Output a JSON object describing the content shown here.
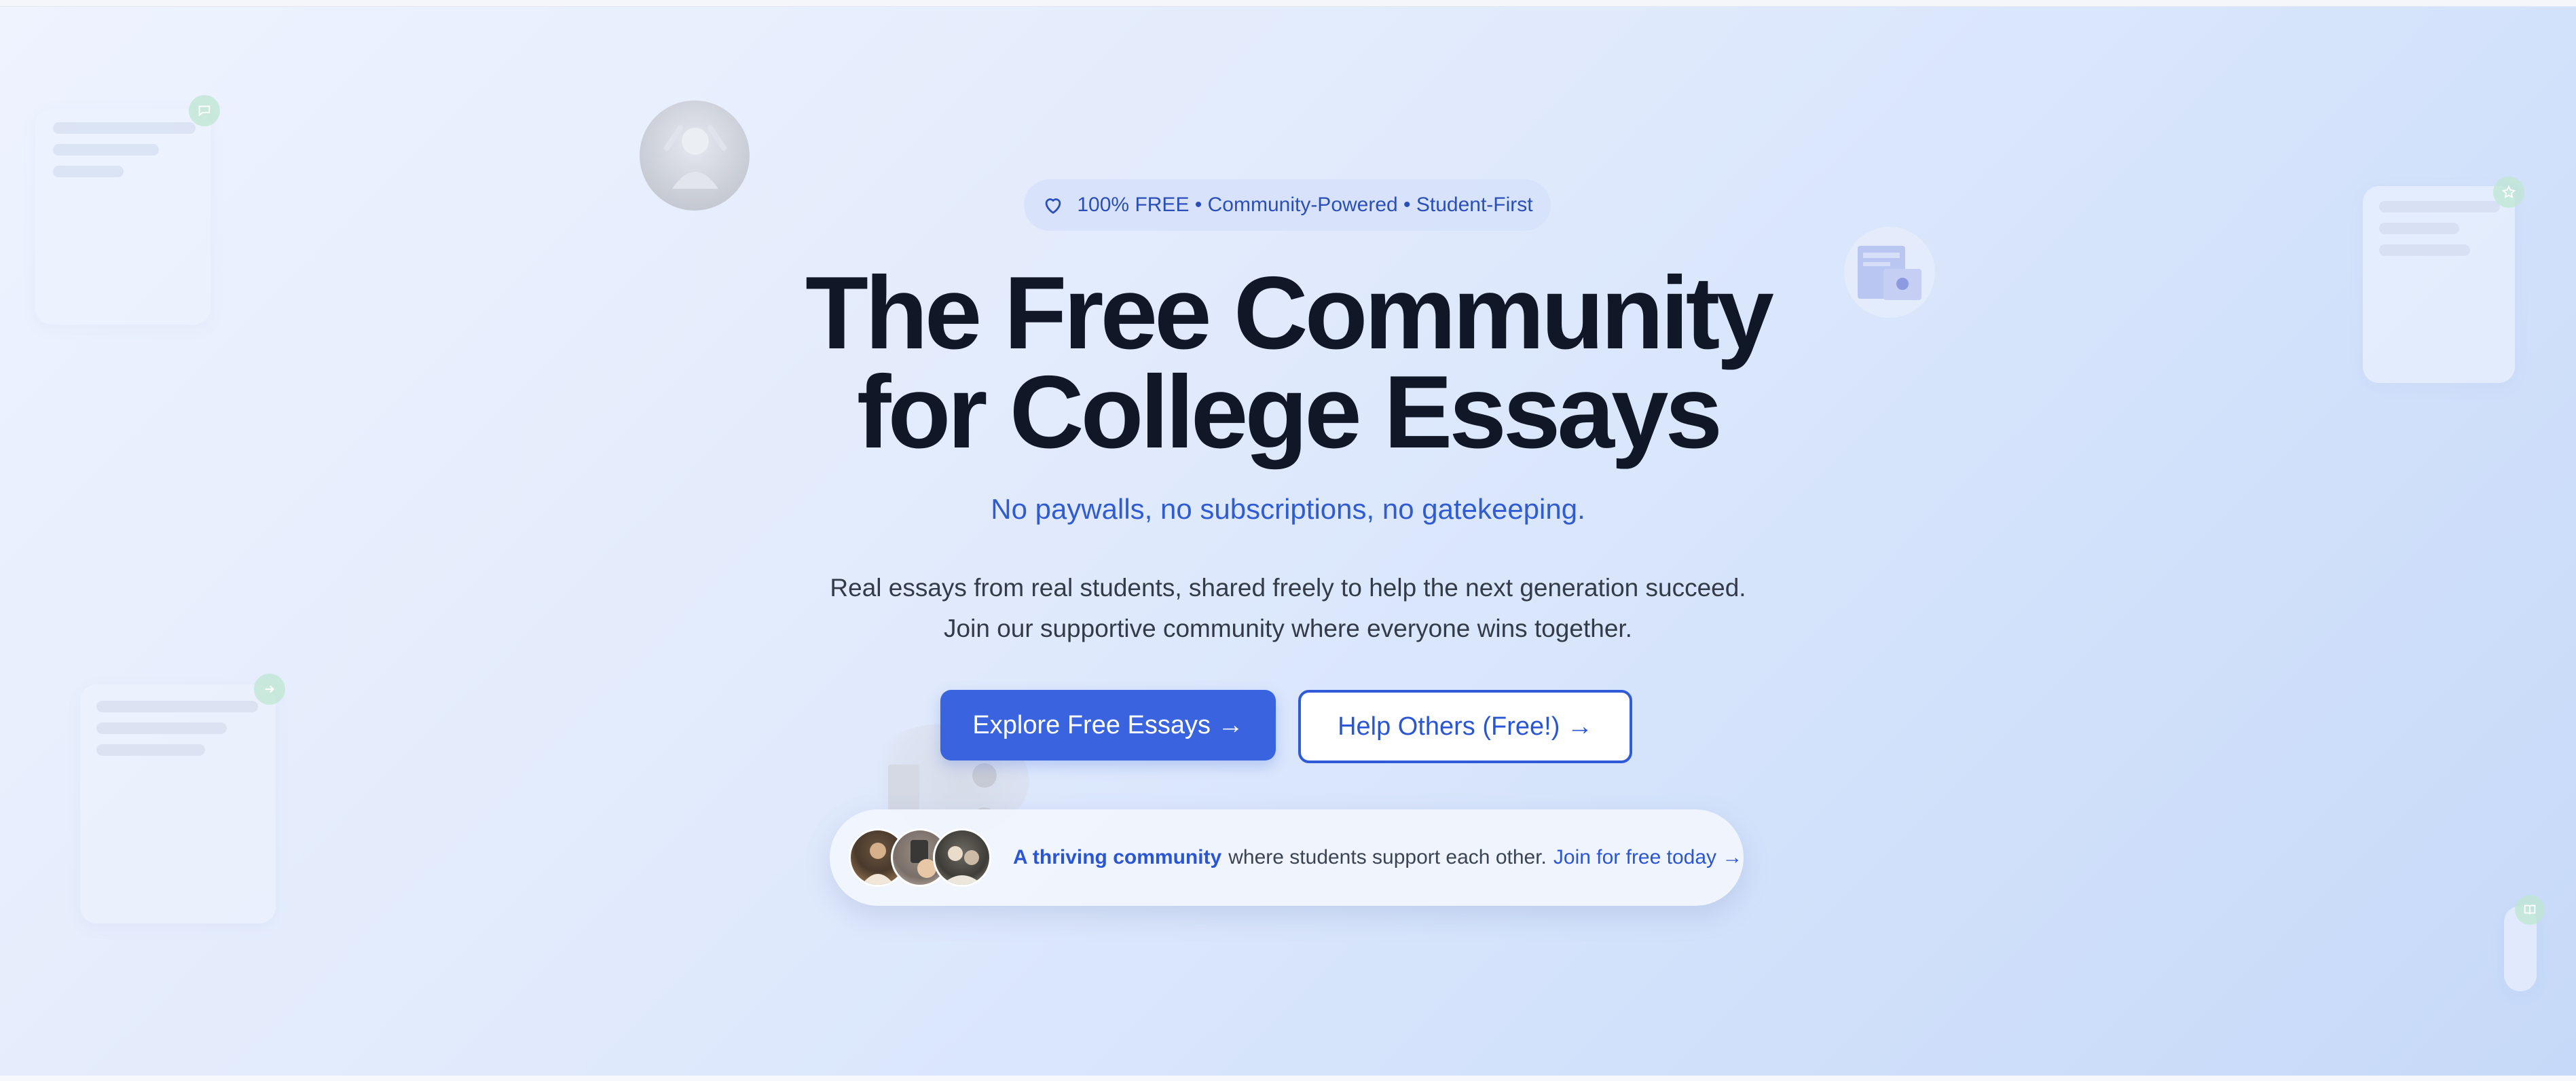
{
  "hero": {
    "badge_text": "100% FREE • Community-Powered • Student-First",
    "title_line1": "The Free Community",
    "title_line2": "for College Essays",
    "subtitle": "No paywalls, no subscriptions, no gatekeeping.",
    "description_line1": "Real essays from real students, shared freely to help the next generation succeed.",
    "description_line2": "Join our supportive community where everyone wins together."
  },
  "buttons": {
    "primary_label": "Explore Free Essays →",
    "secondary_label": "Help Others (Free!) →"
  },
  "community": {
    "highlight": "A thriving community",
    "text": "where students support each other.",
    "link": "Join for free today →"
  },
  "colors": {
    "accent": "#3a63e0",
    "heading": "#101828",
    "link": "#2a55d4",
    "background_start": "#eef3fe",
    "background_end": "#c6d9f8"
  },
  "icons": {
    "badge": "heart-icon",
    "decor_1": "message-icon",
    "decor_2": "star-icon",
    "decor_3": "arrow-icon",
    "decor_4": "book-icon"
  }
}
